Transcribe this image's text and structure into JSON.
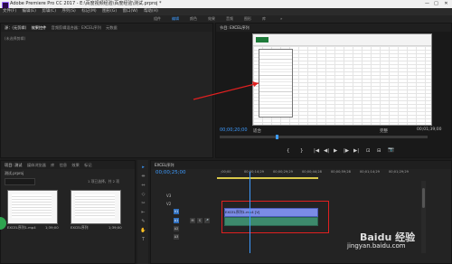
{
  "window": {
    "title": "Adobe Premiere Pro CC 2017 - E:\\百度视频经验\\百度经验\\测试.prproj *",
    "controls": [
      "—",
      "□",
      "✕"
    ]
  },
  "menu": [
    "文件(F)",
    "编辑(E)",
    "剪辑(C)",
    "序列(S)",
    "标记(M)",
    "图形(G)",
    "窗口(W)",
    "帮助(H)"
  ],
  "workspaces": [
    "组件",
    "编辑",
    "颜色",
    "效果",
    "音频",
    "图形",
    "库",
    "»"
  ],
  "source_panel": {
    "tabs": [
      "源：(无剪辑)",
      "效果控件",
      "音频剪辑混合器：EXCEL序列",
      "元数据"
    ],
    "empty_label": "(未选择剪辑)"
  },
  "program": {
    "tab": "节目: EXCEL序列",
    "timecode_left": "00;00;20;00",
    "fit": "适合",
    "zoom_ratio": "完整",
    "timecode_right": "00;01;39;00",
    "transport": [
      "⌐",
      "{",
      "}",
      "|◀",
      "◀|",
      "▶",
      "|▶",
      "▶|",
      "⊡",
      "⊟",
      "📷"
    ]
  },
  "project": {
    "tabs": [
      "项目: 测试",
      "媒体浏览器",
      "库",
      "信息",
      "效果",
      "标记"
    ],
    "path": "测试.prproj",
    "item_count": "1 项已选择，共 2 项",
    "items": [
      {
        "name": "EXCEL序列1.mp4",
        "duration": "1;39;00"
      },
      {
        "name": "EXCEL序列",
        "duration": "1;39;00"
      }
    ]
  },
  "tools": [
    "▸",
    "⇹",
    "⇔",
    "◇",
    "✂",
    "⇤",
    "✎",
    "✋",
    "T"
  ],
  "timeline": {
    "tab": "EXCEL序列",
    "timecode": "00;00;25;00",
    "ruler": [
      ";00;00",
      "00;00;14;29",
      "00;00;29;29",
      "00;00;44;28",
      "00;00;59;28",
      "00;01;14;29",
      "00;01;29;29"
    ],
    "video_tracks": [
      "V3",
      "V2",
      "V1"
    ],
    "audio_tracks": [
      "A1",
      "A2",
      "A3"
    ],
    "clip_label": "EXCEL序列1.mp4 [V]",
    "controls": [
      "M",
      "S",
      "🎤"
    ]
  },
  "watermark": "Baidu 经验",
  "watermark_url": "jingyan.baidu.com",
  "colors": {
    "accent": "#3d9bff",
    "clip_video": "#7b8ce6",
    "clip_audio": "#3d8a6c",
    "annotation": "#e02020"
  },
  "arrow_annotation": "red-arrow"
}
